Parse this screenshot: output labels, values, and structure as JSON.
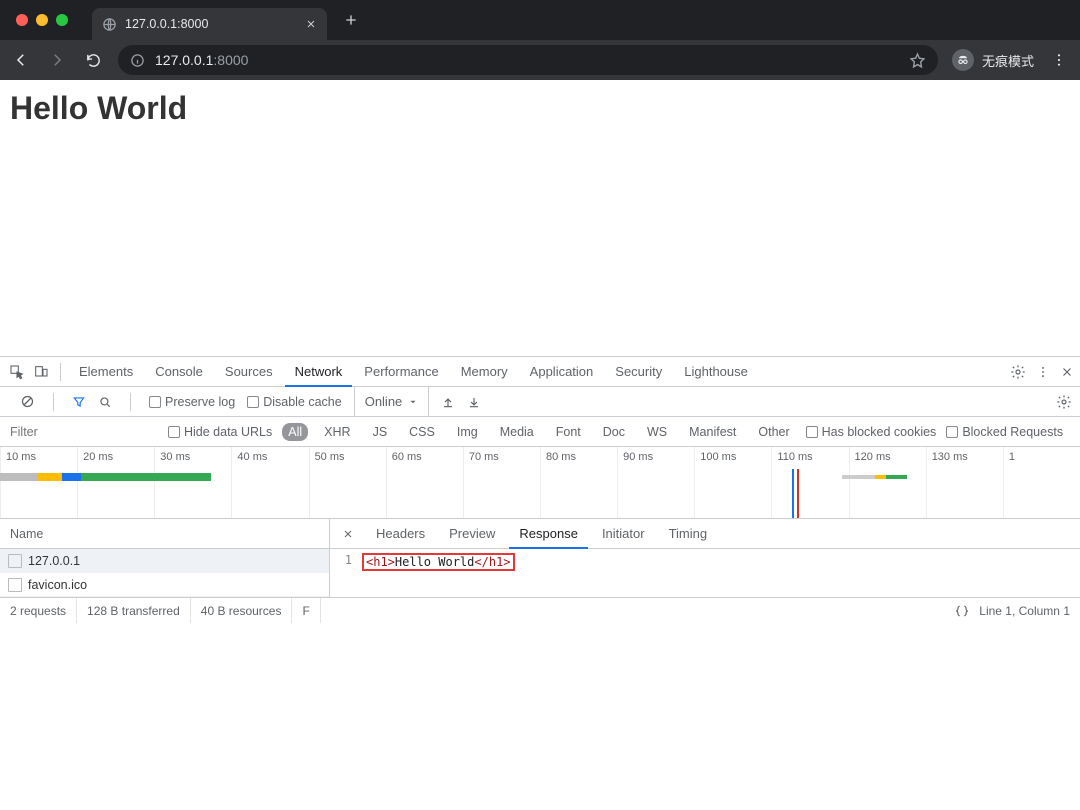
{
  "browser": {
    "tab_title": "127.0.0.1:8000",
    "url_host": "127.0.0.1",
    "url_port": ":8000",
    "incognito_label": "无痕模式"
  },
  "page": {
    "heading": "Hello World"
  },
  "devtools": {
    "tabs": [
      "Elements",
      "Console",
      "Sources",
      "Network",
      "Performance",
      "Memory",
      "Application",
      "Security",
      "Lighthouse"
    ],
    "active_tab": "Network",
    "toolbar": {
      "preserve_log": "Preserve log",
      "disable_cache": "Disable cache",
      "throttle": "Online"
    },
    "filter": {
      "placeholder": "Filter",
      "hide_data_urls": "Hide data URLs",
      "types": [
        "All",
        "XHR",
        "JS",
        "CSS",
        "Img",
        "Media",
        "Font",
        "Doc",
        "WS",
        "Manifest",
        "Other"
      ],
      "has_blocked_cookies": "Has blocked cookies",
      "blocked_requests": "Blocked Requests"
    },
    "timeline_ticks": [
      "10 ms",
      "20 ms",
      "30 ms",
      "40 ms",
      "50 ms",
      "60 ms",
      "70 ms",
      "80 ms",
      "90 ms",
      "100 ms",
      "110 ms",
      "120 ms",
      "130 ms",
      "1"
    ],
    "requests": {
      "header": "Name",
      "items": [
        "127.0.0.1",
        "favicon.ico"
      ]
    },
    "detail": {
      "tabs": [
        "Headers",
        "Preview",
        "Response",
        "Initiator",
        "Timing"
      ],
      "active_tab": "Response",
      "line_number": "1",
      "response_open_tag": "<h1>",
      "response_text": "Hello World",
      "response_close_tag": "</h1>"
    },
    "status": {
      "requests": "2 requests",
      "transferred": "128 B transferred",
      "resources": "40 B resources",
      "truncated": "F",
      "cursor": "Line 1, Column 1"
    }
  }
}
